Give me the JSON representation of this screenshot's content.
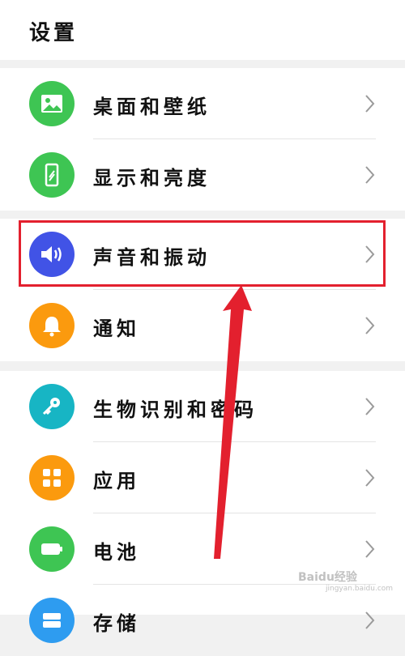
{
  "header": {
    "title": "设置"
  },
  "groups": [
    {
      "items": [
        {
          "label": "桌面和壁纸",
          "icon": "image-icon",
          "color": "#3ec553"
        },
        {
          "label": "显示和亮度",
          "icon": "phone-brightness-icon",
          "color": "#3ec553"
        }
      ]
    },
    {
      "items": [
        {
          "label": "声音和振动",
          "icon": "volume-icon",
          "color": "#4153e6"
        },
        {
          "label": "通知",
          "icon": "bell-icon",
          "color": "#fb9a0e"
        }
      ]
    },
    {
      "items": [
        {
          "label": "生物识别和密码",
          "icon": "key-icon",
          "color": "#17b5c4"
        },
        {
          "label": "应用",
          "icon": "apps-grid-icon",
          "color": "#fb9a0e"
        },
        {
          "label": "电池",
          "icon": "battery-icon",
          "color": "#3ec553"
        },
        {
          "label": "存储",
          "icon": "storage-icon",
          "color": "#2e9cf0"
        }
      ]
    }
  ],
  "annotation": {
    "highlight_color": "#e3202e"
  },
  "watermark": {
    "text": "Baidu经验",
    "sub": "jingyan.baidu.com"
  }
}
